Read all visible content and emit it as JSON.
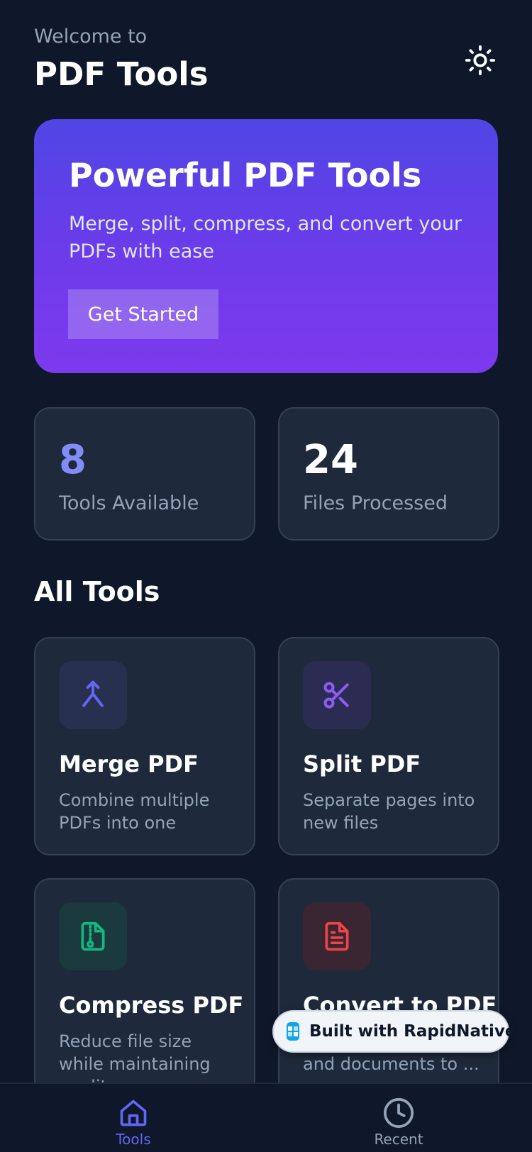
{
  "header": {
    "welcome": "Welcome to",
    "title": "PDF Tools",
    "theme_icon": "sun-icon"
  },
  "hero": {
    "title": "Powerful PDF Tools",
    "subtitle": "Merge, split, compress, and convert your PDFs with ease",
    "button_label": "Get Started"
  },
  "stats": [
    {
      "value": "8",
      "label": "Tools Available",
      "color": "#818cf8"
    },
    {
      "value": "24",
      "label": "Files Processed",
      "color": "#ffffff"
    }
  ],
  "section": {
    "title": "All Tools"
  },
  "tools": [
    {
      "name": "Merge PDF",
      "description": "Combine multiple PDFs into one",
      "icon": "merge-icon",
      "color": "#6366f1"
    },
    {
      "name": "Split PDF",
      "description": "Separate pages into new files",
      "icon": "scissors-icon",
      "color": "#8b5cf6"
    },
    {
      "name": "Compress PDF",
      "description": "Reduce file size while maintaining quality",
      "icon": "file-archive-icon",
      "color": "#10b981"
    },
    {
      "name": "Convert to PDF",
      "description": "and documents to ...",
      "icon": "file-text-icon",
      "color": "#ef4444"
    }
  ],
  "badge": {
    "text": "Built with RapidNative"
  },
  "tabs": [
    {
      "label": "Tools",
      "icon": "home-icon",
      "active": true,
      "color": "#6366f1"
    },
    {
      "label": "Recent",
      "icon": "clock-icon",
      "active": false,
      "color": "#94a3b8"
    }
  ],
  "colors": {
    "background": "#0f172a",
    "card": "#1e293b",
    "accent": "#6366f1",
    "hero_start": "#4f46e5",
    "hero_end": "#7c3aed"
  }
}
